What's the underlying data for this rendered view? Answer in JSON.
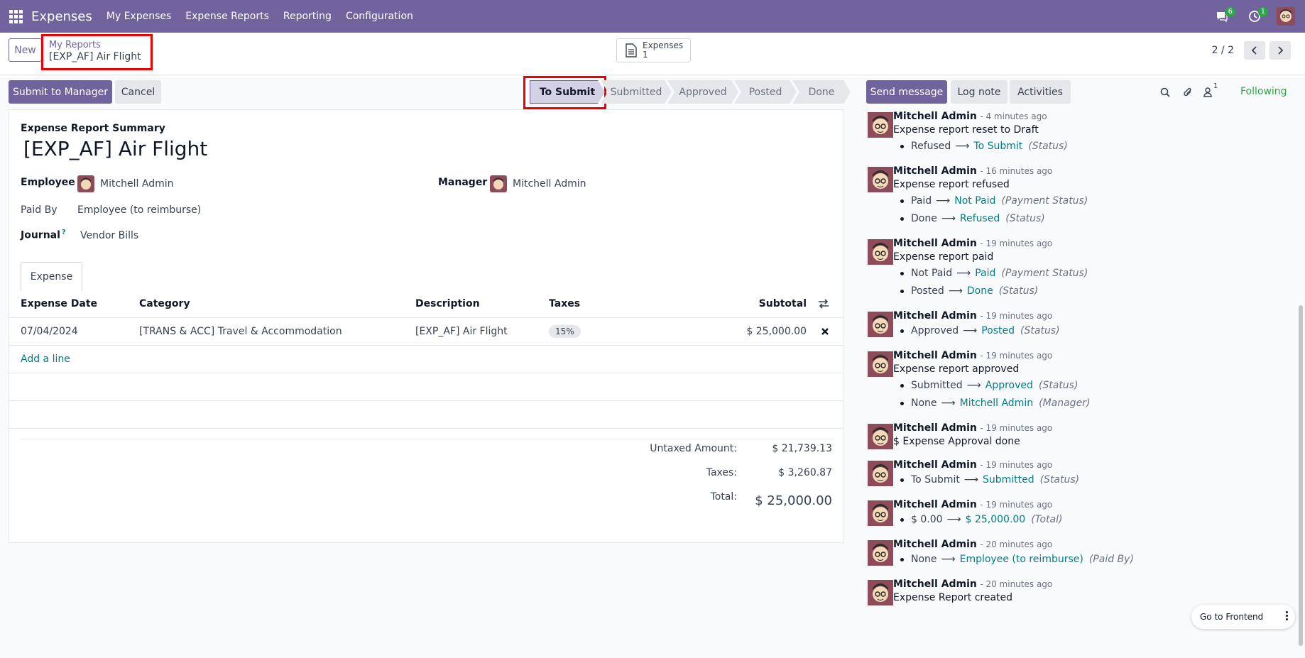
{
  "navbar": {
    "app_name": "Expenses",
    "menu": [
      "My Expenses",
      "Expense Reports",
      "Reporting",
      "Configuration"
    ],
    "messages_count": "6",
    "activities_count": "1"
  },
  "control_panel": {
    "new_label": "New",
    "breadcrumb_parent": "My Reports",
    "breadcrumb_current": "[EXP_AF] Air Flight",
    "smart_button": {
      "label": "Expenses",
      "count": "1"
    },
    "pager": "2 / 2"
  },
  "statusbar": {
    "submit_label": "Submit to Manager",
    "cancel_label": "Cancel",
    "stages": [
      "To Submit",
      "Submitted",
      "Approved",
      "Posted",
      "Done"
    ],
    "active_stage": "To Submit"
  },
  "form": {
    "summary_label": "Expense Report Summary",
    "title": "[EXP_AF] Air Flight",
    "employee_label": "Employee",
    "employee": "Mitchell Admin",
    "manager_label": "Manager",
    "manager": "Mitchell Admin",
    "paid_by_label": "Paid By",
    "paid_by": "Employee (to reimburse)",
    "journal_label": "Journal",
    "journal_help": "?",
    "journal": "Vendor Bills",
    "tab": "Expense",
    "columns": [
      "Expense Date",
      "Category",
      "Description",
      "Taxes",
      "Subtotal"
    ],
    "line": {
      "date": "07/04/2024",
      "category": "[TRANS & ACC] Travel & Accommodation",
      "description": "[EXP_AF] Air Flight",
      "tax": "15%",
      "subtotal": "$ 25,000.00"
    },
    "add_line": "Add a line",
    "untaxed_label": "Untaxed Amount:",
    "untaxed": "$ 21,739.13",
    "taxes_label": "Taxes:",
    "taxes": "$ 3,260.87",
    "total_label": "Total:",
    "total": "$ 25,000.00"
  },
  "chatter": {
    "send_message": "Send message",
    "log_note": "Log note",
    "activities": "Activities",
    "followers_count": "1",
    "following": "Following",
    "messages": [
      {
        "author": "Mitchell Admin",
        "time": "- 4 minutes ago",
        "body": "Expense report reset to Draft",
        "changes": [
          {
            "old": "Refused",
            "new": "To Submit",
            "field": "(Status)"
          }
        ]
      },
      {
        "author": "Mitchell Admin",
        "time": "- 16 minutes ago",
        "body": "Expense report refused",
        "changes": [
          {
            "old": "Paid",
            "new": "Not Paid",
            "field": "(Payment Status)"
          },
          {
            "old": "Done",
            "new": "Refused",
            "field": "(Status)"
          }
        ]
      },
      {
        "author": "Mitchell Admin",
        "time": "- 19 minutes ago",
        "body": "Expense report paid",
        "changes": [
          {
            "old": "Not Paid",
            "new": "Paid",
            "field": "(Payment Status)"
          },
          {
            "old": "Posted",
            "new": "Done",
            "field": "(Status)"
          }
        ]
      },
      {
        "author": "Mitchell Admin",
        "time": "- 19 minutes ago",
        "body": "",
        "changes": [
          {
            "old": "Approved",
            "new": "Posted",
            "field": "(Status)"
          }
        ]
      },
      {
        "author": "Mitchell Admin",
        "time": "- 19 minutes ago",
        "body": "Expense report approved",
        "changes": [
          {
            "old": "Submitted",
            "new": "Approved",
            "field": "(Status)"
          },
          {
            "old": "None",
            "new": "Mitchell Admin",
            "field": "(Manager)"
          }
        ]
      },
      {
        "author": "Mitchell Admin",
        "time": "- 19 minutes ago",
        "body": "$ Expense Approval done",
        "changes": []
      },
      {
        "author": "Mitchell Admin",
        "time": "- 19 minutes ago",
        "body": "",
        "changes": [
          {
            "old": "To Submit",
            "new": "Submitted",
            "field": "(Status)"
          }
        ]
      },
      {
        "author": "Mitchell Admin",
        "time": "- 19 minutes ago",
        "body": "",
        "changes": [
          {
            "old": "$ 0.00",
            "new": "$ 25,000.00",
            "field": "(Total)"
          }
        ]
      },
      {
        "author": "Mitchell Admin",
        "time": "- 20 minutes ago",
        "body": "",
        "changes": [
          {
            "old": "None",
            "new": "Employee (to reimburse)",
            "field": "(Paid By)"
          }
        ]
      },
      {
        "author": "Mitchell Admin",
        "time": "- 20 minutes ago",
        "body": "Expense Report created",
        "changes": []
      }
    ]
  },
  "go_frontend": "Go to Frontend",
  "colors": {
    "brand": "#71639e",
    "link": "#017e84",
    "highlight": "#ff0000"
  }
}
